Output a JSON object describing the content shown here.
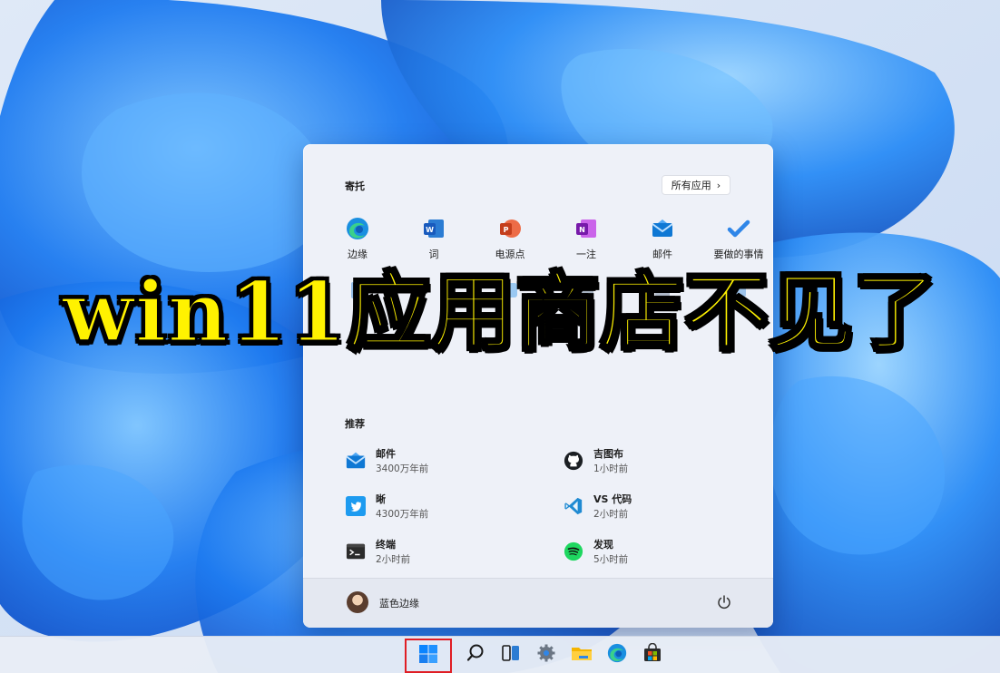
{
  "overlay": {
    "title": "win11应用商店不见了"
  },
  "start_menu": {
    "pinned": {
      "title": "寄托",
      "all_apps_label": "所有应用",
      "apps": [
        {
          "label": "边缘",
          "icon": "edge-icon"
        },
        {
          "label": "词",
          "icon": "word-icon"
        },
        {
          "label": "电源点",
          "icon": "powerpoint-icon"
        },
        {
          "label": "一注",
          "icon": "onenote-icon"
        },
        {
          "label": "邮件",
          "icon": "mail-icon"
        },
        {
          "label": "要做的事情",
          "icon": "todo-icon"
        }
      ]
    },
    "recommended": {
      "title": "推荐",
      "items": [
        {
          "name": "邮件",
          "time": "3400万年前",
          "icon": "mail-icon"
        },
        {
          "name": "吉图布",
          "time": "1小时前",
          "icon": "github-icon"
        },
        {
          "name": "晰",
          "time": "4300万年前",
          "icon": "twitter-icon"
        },
        {
          "name": "VS 代码",
          "time": "2小时前",
          "icon": "vscode-icon"
        },
        {
          "name": "终端",
          "time": "2小时前",
          "icon": "terminal-icon"
        },
        {
          "name": "发现",
          "time": "5小时前",
          "icon": "spotify-icon"
        }
      ]
    },
    "user": {
      "name": "蓝色边缘"
    }
  },
  "taskbar": {
    "icons": [
      "windows-start-icon",
      "search-icon",
      "task-view-icon",
      "settings-icon",
      "file-explorer-icon",
      "edge-icon",
      "store-icon"
    ]
  },
  "colors": {
    "accent": "#0067c0",
    "overlay_text": "#fff200",
    "highlight": "#e01e25"
  }
}
